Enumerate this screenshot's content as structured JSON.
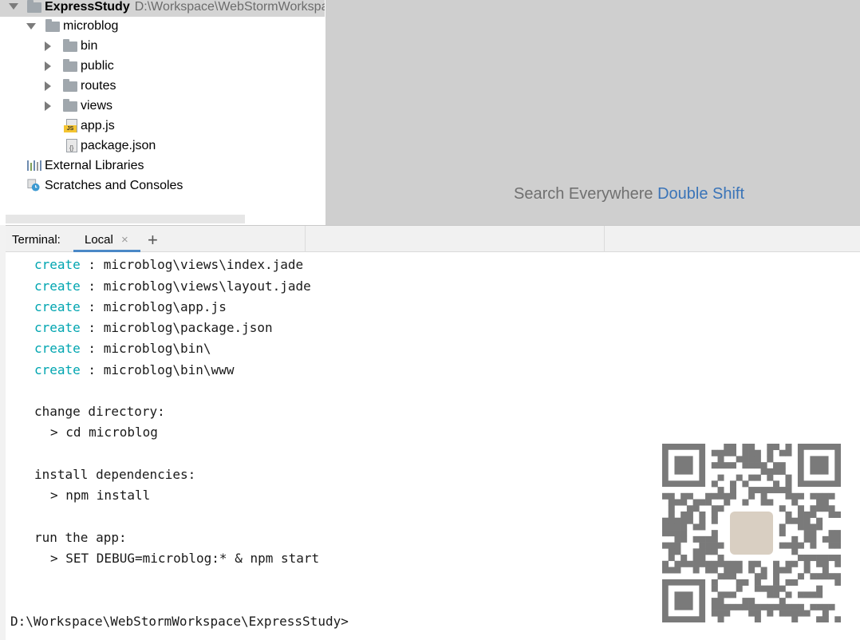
{
  "project_tree": {
    "root": {
      "label": "ExpressStudy",
      "path": "D:\\Workspace\\WebStormWorkspace"
    },
    "items": [
      {
        "label": "microblog",
        "kind": "folder",
        "expanded": true
      },
      {
        "label": "bin",
        "kind": "folder"
      },
      {
        "label": "public",
        "kind": "folder"
      },
      {
        "label": "routes",
        "kind": "folder"
      },
      {
        "label": "views",
        "kind": "folder"
      },
      {
        "label": "app.js",
        "kind": "js-file"
      },
      {
        "label": "package.json",
        "kind": "json-file"
      }
    ],
    "external_libraries": "External Libraries",
    "scratches": "Scratches and Consoles"
  },
  "editor": {
    "hint_text": "Search Everywhere",
    "hint_shortcut": "Double Shift"
  },
  "terminal": {
    "title": "Terminal:",
    "tab_label": "Local",
    "close_glyph": "×",
    "add_glyph": "+",
    "create_keyword": "create",
    "created_files": [
      " : microblog\\views\\index.jade",
      " : microblog\\views\\layout.jade",
      " : microblog\\app.js",
      " : microblog\\package.json",
      " : microblog\\bin\\",
      " : microblog\\bin\\www"
    ],
    "change_dir_header": "change directory:",
    "change_dir_cmd": "> cd microblog",
    "install_header": "install dependencies:",
    "install_cmd": "> npm install",
    "run_header": "run the app:",
    "run_cmd": "> SET DEBUG=microblog:* & npm start",
    "prompt": "D:\\Workspace\\WebStormWorkspace\\ExpressStudy>"
  },
  "colors": {
    "keyword": "#00a5b0",
    "accent": "#4a88c7",
    "shortcut": "#3a74b8"
  }
}
